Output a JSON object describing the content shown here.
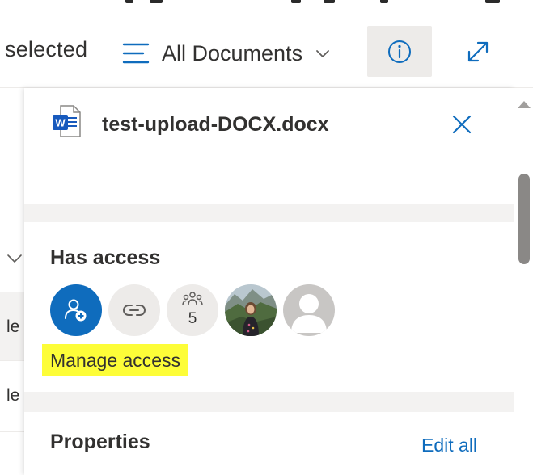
{
  "command_bar": {
    "selected_text": "selected",
    "view_label": "All Documents",
    "view_icon": "list-lines-icon",
    "view_chevron_icon": "chevron-down-icon",
    "info_icon": "info-icon",
    "expand_icon": "expand-icon"
  },
  "list": {
    "row_texts": [
      "le",
      "le"
    ]
  },
  "details": {
    "file_name": "test-upload-DOCX.docx",
    "file_icon": "word-document-icon",
    "close_icon": "close-icon",
    "has_access": {
      "title": "Has access",
      "group_count": "5",
      "manage_access_label": "Manage access",
      "highlight_color": "#fdfd38"
    },
    "properties": {
      "title": "Properties",
      "edit_all_label": "Edit all"
    }
  },
  "colors": {
    "accent": "#0f6cbd",
    "pane_background": "#f3f2f1",
    "text": "#323130"
  }
}
